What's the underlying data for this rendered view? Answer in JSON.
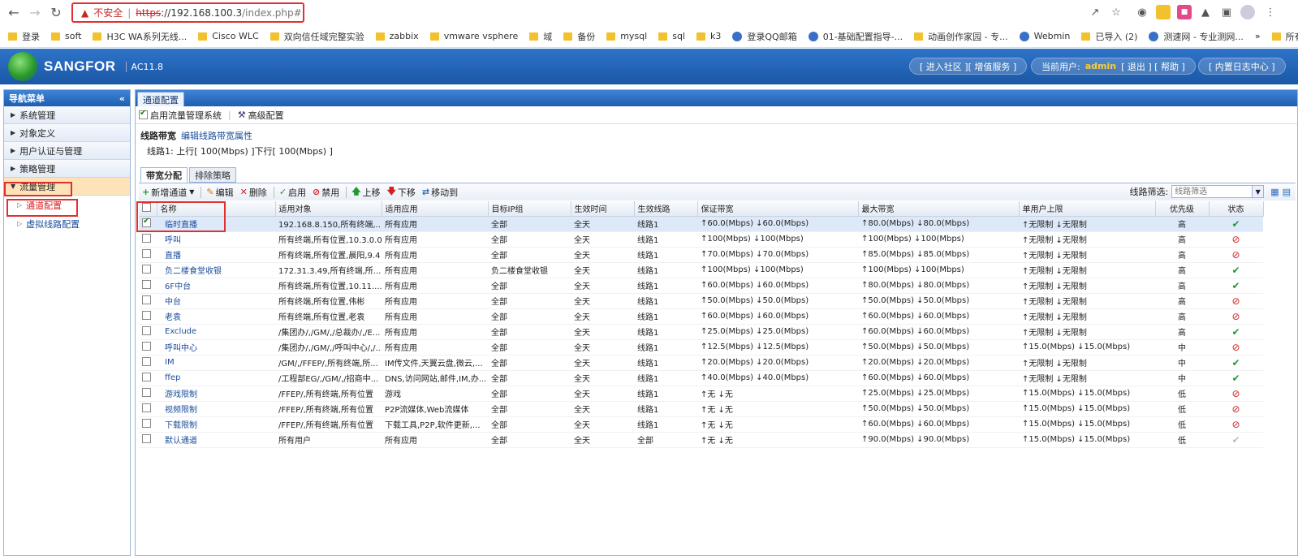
{
  "browser": {
    "insecure_label": "不安全",
    "url_scheme": "https",
    "url_host": "://192.168.100.3",
    "url_path": "/index.php#",
    "bookmarks": [
      "登录",
      "soft",
      "H3C WA系列无线...",
      "Cisco WLC",
      "双向信任域完整实验",
      "zabbix",
      "vmware vsphere",
      "域",
      "备份",
      "mysql",
      "sql",
      "k3",
      "登录QQ邮箱",
      "01-基础配置指导-...",
      "动画创作家园 - 专...",
      "Webmin",
      "已导入 (2)",
      "测速网 - 专业测网...",
      "所有书签"
    ]
  },
  "header": {
    "brand": "SANGFOR",
    "version": "AC11.8",
    "links1": "[ 进入社区 ][ 增值服务 ]",
    "user_prefix": "当前用户:",
    "user": "admin",
    "links2": "[ 退出 ] [ 帮助 ]",
    "links3": "[ 内置日志中心 ]"
  },
  "sidebar": {
    "title": "导航菜单",
    "collapse": "«",
    "menus": [
      "系统管理",
      "对象定义",
      "用户认证与管理",
      "策略管理",
      "流量管理"
    ],
    "subs": [
      "通道配置",
      "虚拟线路配置"
    ]
  },
  "main": {
    "tab": "通道配置",
    "enable_label": "启用流量管理系统",
    "advanced_label": "高级配置",
    "line_bw_label": "线路带宽",
    "edit_line_label": "编辑线路带宽属性",
    "line_summary": "线路1: 上行[ 100(Mbps) ]下行[ 100(Mbps) ]",
    "subtabs": [
      "带宽分配",
      "排除策略"
    ],
    "toolbar": {
      "add": "新增通道",
      "edit": "编辑",
      "delete": "删除",
      "enable": "启用",
      "disable": "禁用",
      "up": "上移",
      "down": "下移",
      "moveto": "移动到",
      "filter_label": "线路筛选:",
      "filter_placeholder": "线路筛选"
    },
    "columns": [
      "名称",
      "适用对象",
      "适用应用",
      "目标IP组",
      "生效时间",
      "生效线路",
      "保证带宽",
      "最大带宽",
      "单用户上限",
      "优先级",
      "状态"
    ],
    "rows": [
      {
        "name": "临时直播",
        "obj": "192.168.8.150,所有终端,...",
        "app": "所有应用",
        "ip": "全部",
        "time": "全天",
        "line": "线路1",
        "guar": "↑60.0(Mbps) ↓60.0(Mbps)",
        "max": "↑80.0(Mbps) ↓80.0(Mbps)",
        "user": "↑无限制 ↓无限制",
        "pri": "高",
        "status": "ok",
        "checked": true
      },
      {
        "name": "呼叫",
        "obj": "所有终端,所有位置,10.3.0.0",
        "app": "所有应用",
        "ip": "全部",
        "time": "全天",
        "line": "线路1",
        "guar": "↑100(Mbps) ↓100(Mbps)",
        "max": "↑100(Mbps) ↓100(Mbps)",
        "user": "↑无限制 ↓无限制",
        "pri": "高",
        "status": "no",
        "checked": false
      },
      {
        "name": "直播",
        "obj": "所有终端,所有位置,晨阳,9.4",
        "app": "所有应用",
        "ip": "全部",
        "time": "全天",
        "line": "线路1",
        "guar": "↑70.0(Mbps) ↓70.0(Mbps)",
        "max": "↑85.0(Mbps) ↓85.0(Mbps)",
        "user": "↑无限制 ↓无限制",
        "pri": "高",
        "status": "no",
        "checked": false
      },
      {
        "name": "负二楼食堂收银",
        "obj": "172.31.3.49,所有终端,所...",
        "app": "所有应用",
        "ip": "负二楼食堂收银",
        "time": "全天",
        "line": "线路1",
        "guar": "↑100(Mbps) ↓100(Mbps)",
        "max": "↑100(Mbps) ↓100(Mbps)",
        "user": "↑无限制 ↓无限制",
        "pri": "高",
        "status": "ok",
        "checked": false
      },
      {
        "name": "6F中台",
        "obj": "所有终端,所有位置,10.11....",
        "app": "所有应用",
        "ip": "全部",
        "time": "全天",
        "line": "线路1",
        "guar": "↑60.0(Mbps) ↓60.0(Mbps)",
        "max": "↑80.0(Mbps) ↓80.0(Mbps)",
        "user": "↑无限制 ↓无限制",
        "pri": "高",
        "status": "ok",
        "checked": false
      },
      {
        "name": "中台",
        "obj": "所有终端,所有位置,伟彬",
        "app": "所有应用",
        "ip": "全部",
        "time": "全天",
        "line": "线路1",
        "guar": "↑50.0(Mbps) ↓50.0(Mbps)",
        "max": "↑50.0(Mbps) ↓50.0(Mbps)",
        "user": "↑无限制 ↓无限制",
        "pri": "高",
        "status": "no",
        "checked": false
      },
      {
        "name": "老袁",
        "obj": "所有终端,所有位置,老袁",
        "app": "所有应用",
        "ip": "全部",
        "time": "全天",
        "line": "线路1",
        "guar": "↑60.0(Mbps) ↓60.0(Mbps)",
        "max": "↑60.0(Mbps) ↓60.0(Mbps)",
        "user": "↑无限制 ↓无限制",
        "pri": "高",
        "status": "no",
        "checked": false
      },
      {
        "name": "Exclude",
        "obj": "/集团办/,/GM/,/总裁办/,/E...",
        "app": "所有应用",
        "ip": "全部",
        "time": "全天",
        "line": "线路1",
        "guar": "↑25.0(Mbps) ↓25.0(Mbps)",
        "max": "↑60.0(Mbps) ↓60.0(Mbps)",
        "user": "↑无限制 ↓无限制",
        "pri": "高",
        "status": "ok",
        "checked": false
      },
      {
        "name": "呼叫中心",
        "obj": "/集团办/,/GM/,/呼叫中心/,/...",
        "app": "所有应用",
        "ip": "全部",
        "time": "全天",
        "line": "线路1",
        "guar": "↑12.5(Mbps) ↓12.5(Mbps)",
        "max": "↑50.0(Mbps) ↓50.0(Mbps)",
        "user": "↑15.0(Mbps) ↓15.0(Mbps)",
        "pri": "中",
        "status": "no",
        "checked": false
      },
      {
        "name": "IM",
        "obj": "/GM/,/FFEP/,所有终端,所...",
        "app": "IM传文件,天翼云盘,微云,...",
        "ip": "全部",
        "time": "全天",
        "line": "线路1",
        "guar": "↑20.0(Mbps) ↓20.0(Mbps)",
        "max": "↑20.0(Mbps) ↓20.0(Mbps)",
        "user": "↑无限制 ↓无限制",
        "pri": "中",
        "status": "ok",
        "checked": false
      },
      {
        "name": "ffep",
        "obj": "/工程部EG/,/GM/,/招商中...",
        "app": "DNS,访问网站,邮件,IM,办...",
        "ip": "全部",
        "time": "全天",
        "line": "线路1",
        "guar": "↑40.0(Mbps) ↓40.0(Mbps)",
        "max": "↑60.0(Mbps) ↓60.0(Mbps)",
        "user": "↑无限制 ↓无限制",
        "pri": "中",
        "status": "ok",
        "checked": false
      },
      {
        "name": "游戏限制",
        "obj": "/FFEP/,所有终端,所有位置",
        "app": "游戏",
        "ip": "全部",
        "time": "全天",
        "line": "线路1",
        "guar": "↑无 ↓无",
        "max": "↑25.0(Mbps) ↓25.0(Mbps)",
        "user": "↑15.0(Mbps) ↓15.0(Mbps)",
        "pri": "低",
        "status": "no",
        "checked": false
      },
      {
        "name": "视频限制",
        "obj": "/FFEP/,所有终端,所有位置",
        "app": "P2P流媒体,Web流媒体",
        "ip": "全部",
        "time": "全天",
        "line": "线路1",
        "guar": "↑无 ↓无",
        "max": "↑50.0(Mbps) ↓50.0(Mbps)",
        "user": "↑15.0(Mbps) ↓15.0(Mbps)",
        "pri": "低",
        "status": "no",
        "checked": false
      },
      {
        "name": "下载限制",
        "obj": "/FFEP/,所有终端,所有位置",
        "app": "下载工具,P2P,软件更新,...",
        "ip": "全部",
        "time": "全天",
        "line": "线路1",
        "guar": "↑无 ↓无",
        "max": "↑60.0(Mbps) ↓60.0(Mbps)",
        "user": "↑15.0(Mbps) ↓15.0(Mbps)",
        "pri": "低",
        "status": "no",
        "checked": false
      },
      {
        "name": "默认通道",
        "obj": "所有用户",
        "app": "所有应用",
        "ip": "全部",
        "time": "全天",
        "line": "全部",
        "guar": "↑无 ↓无",
        "max": "↑90.0(Mbps) ↓90.0(Mbps)",
        "user": "↑15.0(Mbps) ↓15.0(Mbps)",
        "pri": "低",
        "status": "dis",
        "checked": false
      }
    ]
  }
}
